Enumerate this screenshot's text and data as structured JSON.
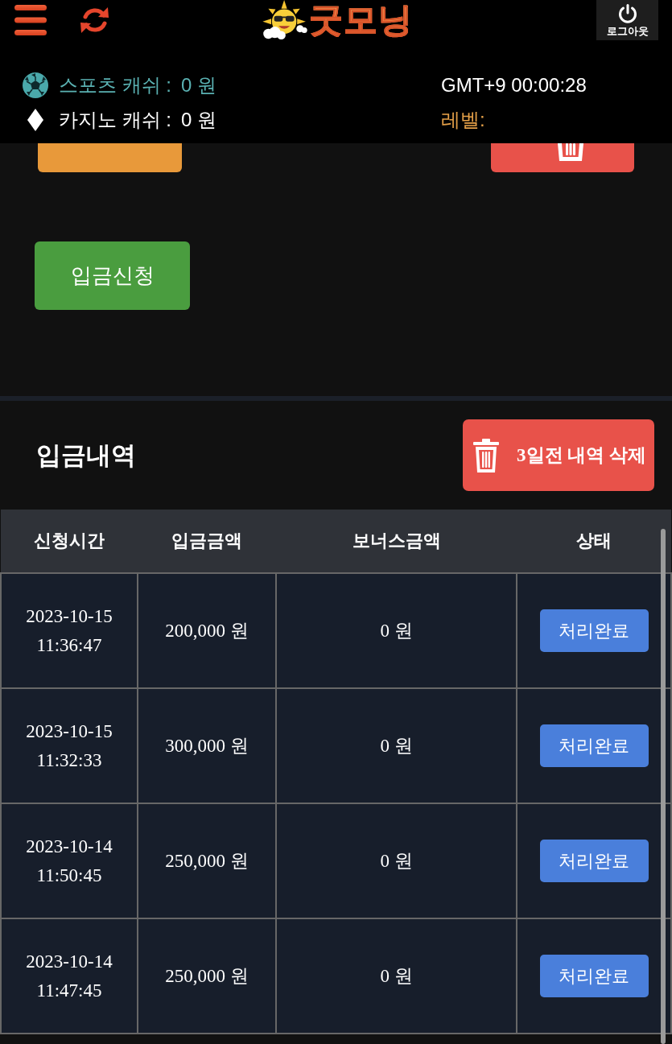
{
  "header": {
    "logo_text": "굿모닝",
    "logout_label": "로그아웃",
    "cash": [
      {
        "kind": "sports",
        "label": "스포츠 캐쉬 :",
        "value": "0 원"
      },
      {
        "kind": "casino",
        "label": "카지노 캐쉬 :",
        "value": "0 원"
      }
    ],
    "clock": "GMT+9 00:00:28",
    "level_label": "레벨:"
  },
  "deposit_request_button": "입금신청",
  "history": {
    "title": "입금내역",
    "delete_button": "3일전 내역 삭제",
    "columns": [
      "신청시간",
      "입금금액",
      "보너스금액",
      "상태"
    ],
    "rows": [
      {
        "time": "2023-10-15 11:36:47",
        "amount": "200,000 원",
        "bonus": "0 원",
        "status": "처리완료"
      },
      {
        "time": "2023-10-15 11:32:33",
        "amount": "300,000 원",
        "bonus": "0 원",
        "status": "처리완료"
      },
      {
        "time": "2023-10-14 11:50:45",
        "amount": "250,000 원",
        "bonus": "0 원",
        "status": "처리완료"
      },
      {
        "time": "2023-10-14 11:47:45",
        "amount": "250,000 원",
        "bonus": "0 원",
        "status": "처리완료"
      }
    ]
  }
}
